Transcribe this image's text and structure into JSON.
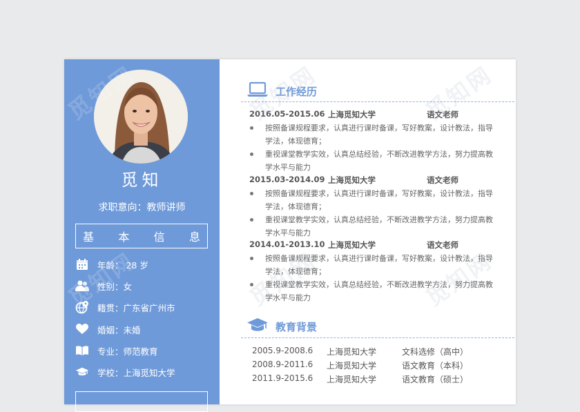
{
  "person": {
    "name": "觅知",
    "objective": "求职意向：教师讲师"
  },
  "basic_info": {
    "title_chars": [
      "基",
      "本",
      "信",
      "息"
    ],
    "items": [
      {
        "icon": "calendar-icon",
        "text": "年龄： 28 岁"
      },
      {
        "icon": "people-icon",
        "text": "性别：女"
      },
      {
        "icon": "globe-location-icon",
        "text": "籍贯：广东省广州市"
      },
      {
        "icon": "heart-icon",
        "text": "婚姻：未婚"
      },
      {
        "icon": "book-icon",
        "text": "专业：师范教育"
      },
      {
        "icon": "graduation-cap-icon",
        "text": "学校：上海觅知大学"
      }
    ]
  },
  "work": {
    "title": "工作经历",
    "jobs": [
      {
        "period": "2016.05-2015.06",
        "company": "上海觅知大学",
        "role": "语文老师",
        "bullets": [
          "按照备课规程要求，认真进行课时备课，写好教案，设计教法，指导学法，体现德育；",
          "重视课堂教学实效，认真总结经验，不断改进教学方法，努力提高教学水平与能力"
        ]
      },
      {
        "period": "2015.03-2014.09",
        "company": "上海觅知大学",
        "role": "语文老师",
        "bullets": [
          "按照备课规程要求，认真进行课时备课，写好教案，设计教法，指导学法，体现德育；",
          "重视课堂教学实效，认真总结经验，不断改进教学方法，努力提高教学水平与能力"
        ]
      },
      {
        "period": "2014.01-2013.10",
        "company": "上海觅知大学",
        "role": "语文老师",
        "bullets": [
          "按照备课规程要求，认真进行课时备课，写好教案，设计教法，指导学法，体现德育；",
          "重视课堂教学实效，认真总结经验，不断改进教学方法，努力提高教学水平与能力"
        ]
      }
    ]
  },
  "education": {
    "title": "教育背景",
    "rows": [
      {
        "period": "2005.9-2008.6",
        "school": "上海觅知大学",
        "major": "文科选修（高中）"
      },
      {
        "period": "2008.9-2011.6",
        "school": "上海觅知大学",
        "major": "语文教育（本科）"
      },
      {
        "period": "2011.9-2015.6",
        "school": "上海觅知大学",
        "major": "语文教育（硕士）"
      }
    ]
  },
  "watermark_text": "觅知网",
  "colors": {
    "accent": "#6f9ad9",
    "sidebar": "#6f9ad9",
    "text": "#555555"
  }
}
